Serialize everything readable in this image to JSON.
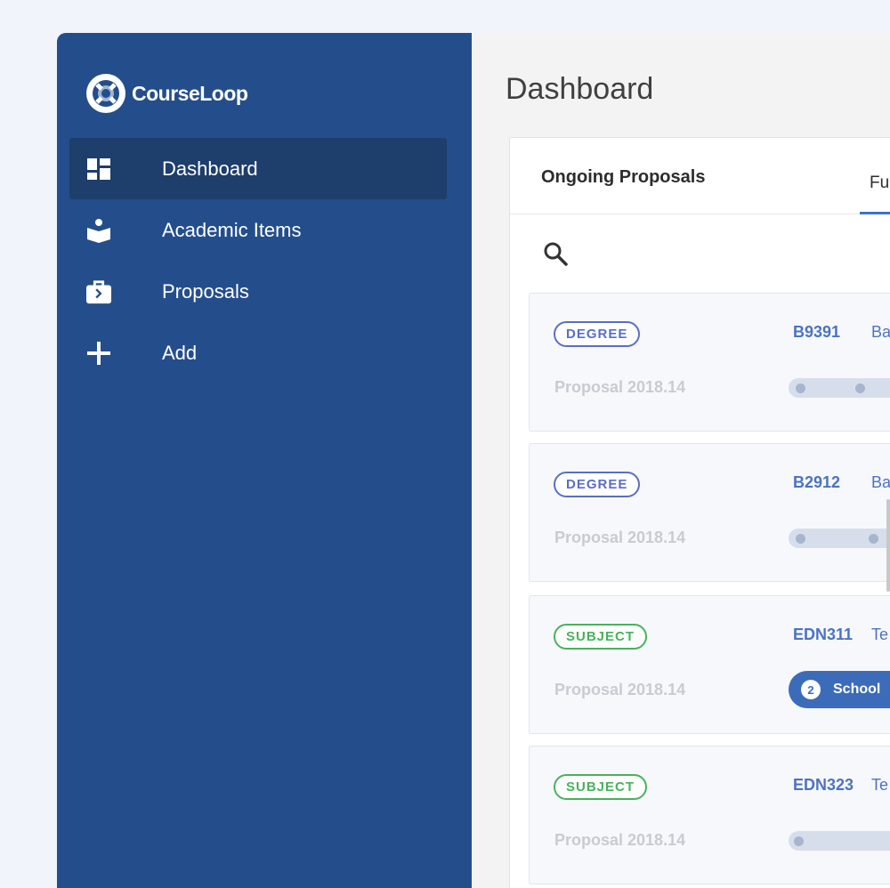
{
  "brand": {
    "name": "CourseLoop",
    "logo_icon": "lifebuoy-logo-icon"
  },
  "sidebar": {
    "items": [
      {
        "label": "Dashboard",
        "icon": "dashboard-icon",
        "active": true
      },
      {
        "label": "Academic Items",
        "icon": "book-reader-icon",
        "active": false
      },
      {
        "label": "Proposals",
        "icon": "briefcase-icon",
        "active": false
      },
      {
        "label": "Add",
        "icon": "plus-icon",
        "active": false
      }
    ]
  },
  "main": {
    "page_title": "Dashboard",
    "panel": {
      "title": "Ongoing Proposals",
      "tab_partial": "Fu",
      "search_icon": "search-icon"
    },
    "cards": [
      {
        "type": "DEGREE",
        "code": "B9391",
        "name_partial": "Ba",
        "proposal": "Proposal 2018.14",
        "progress": "track",
        "steps_visible": 2
      },
      {
        "type": "DEGREE",
        "code": "B2912",
        "name_partial": "Ba",
        "proposal": "Proposal 2018.14",
        "progress": "track",
        "steps_visible": 2
      },
      {
        "type": "SUBJECT",
        "code": "EDN311",
        "name_partial": "Te",
        "proposal": "Proposal 2018.14",
        "progress": "stage",
        "stage_number": "2",
        "stage_label": "School"
      },
      {
        "type": "SUBJECT",
        "code": "EDN323",
        "name_partial": "Te",
        "proposal": "Proposal 2018.14",
        "progress": "track",
        "steps_visible": 1
      }
    ]
  },
  "colors": {
    "sidebar_bg": "#244e8b",
    "active_item_bg": "#1e3e6b",
    "degree_badge": "#5a6ec4",
    "subject_badge": "#46b35a",
    "link": "#4c73c2"
  }
}
